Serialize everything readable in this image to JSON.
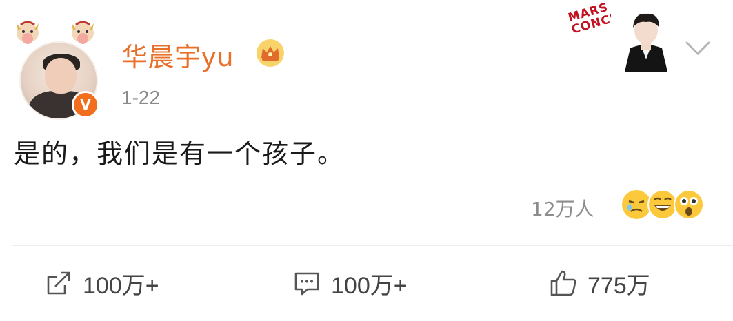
{
  "post": {
    "username": "华晨宇yu",
    "timestamp": "1-22",
    "content": "是的，我们是有一个孩子。",
    "reactions": {
      "count_label": "12万人",
      "emojis": [
        "crying-face",
        "laughing-face",
        "shocked-face"
      ]
    },
    "actions": {
      "share": {
        "count": "100万+",
        "icon": "share-icon"
      },
      "comment": {
        "count": "100万+",
        "icon": "comment-icon"
      },
      "like": {
        "count": "775万",
        "icon": "thumbs-up-icon"
      }
    }
  },
  "promo": {
    "text_line1": "MARS",
    "text_line2": "CONCERT"
  },
  "colors": {
    "username": "#e8702a",
    "badge": "#f26d1c",
    "muted": "#8a8a8a",
    "promo": "#c2121f"
  }
}
